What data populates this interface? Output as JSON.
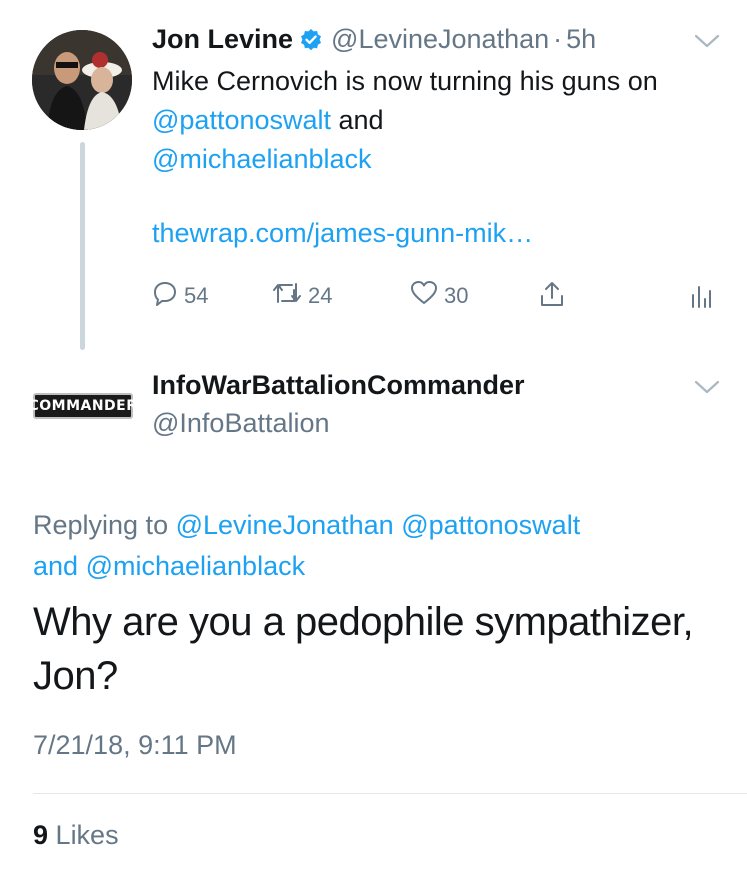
{
  "parent_tweet": {
    "author_name": "Jon Levine",
    "handle": "@LevineJonathan",
    "time_separator": "·",
    "time": "5h",
    "text_before": "Mike Cernovich is now turning his guns on ",
    "mention1": "@pattonoswalt",
    "text_middle": " and ",
    "mention2": "@michaelianblack",
    "link": "thewrap.com/james-gunn-mik…",
    "reply_count": "54",
    "retweet_count": "24",
    "like_count": "30"
  },
  "reply_tweet": {
    "author_name": "InfoWarBattalionCommander",
    "handle": "@InfoBattalion",
    "badge_text": "COMMANDER",
    "replying_prefix": "Replying to ",
    "replying_mention1": "@LevineJonathan",
    "replying_mention2": "@pattonoswalt",
    "replying_and": "and",
    "replying_mention3": "@michaelianblack",
    "text": "Why are you a pedophile sympathizer, Jon?",
    "timestamp": "7/21/18, 9:11 PM",
    "likes_count": "9",
    "likes_label": "Likes"
  },
  "colors": {
    "link": "#1da1f2",
    "secondary_text": "#657786",
    "verified": "#1da1f2",
    "thread_line": "#ccd6dd"
  },
  "icons": [
    "verified-badge-icon",
    "chevron-down-icon",
    "reply-icon",
    "retweet-icon",
    "like-icon",
    "share-icon",
    "analytics-icon"
  ]
}
